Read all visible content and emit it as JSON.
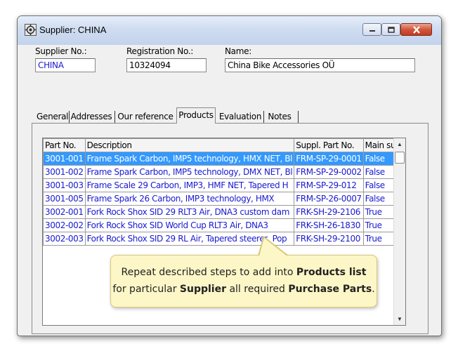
{
  "window": {
    "title": "Supplier: CHINA"
  },
  "fields": {
    "supplier_no": {
      "label": "Supplier No.:",
      "value": "CHINA"
    },
    "registration_no": {
      "label": "Registration No.:",
      "value": "10324094"
    },
    "name": {
      "label": "Name:",
      "value": "China Bike Accessories OÜ"
    }
  },
  "tabs": [
    "General",
    "Addresses",
    "Our reference",
    "Products",
    "Evaluation",
    "Notes"
  ],
  "active_tab": "Products",
  "products_table": {
    "columns": [
      "Part No.",
      "Description",
      "Suppl. Part No.",
      "Main suppl."
    ],
    "rows": [
      [
        "3001-001",
        "Frame Spark Carbon, IMP5 technology, HMX NET, Bl",
        "FRM-SP-29-0001",
        "False"
      ],
      [
        "3001-002",
        "Frame Spark Carbon, IMP5 technology, DMX NET, Bl",
        "FRM-SP-29-0002",
        "False"
      ],
      [
        "3001-003",
        "Frame Scale 29 Carbon, IMP3, HMF NET, Tapered H",
        "FRM-SP-29-012",
        "False"
      ],
      [
        "3001-005",
        "Frame Spark 26 Carbon, IMP3 technology, HMX",
        "FRM-SP-26-0007",
        "False"
      ],
      [
        "3002-001",
        "Fork Rock Shox SID 29 RLT3 Air, DNA3 custom dam",
        "FRK-SH-29-2106",
        "True"
      ],
      [
        "3002-002",
        "Fork Rock Shox SID World Cup RLT3 Air, DNA3",
        "FRK-SH-26-1830",
        "True"
      ],
      [
        "3002-003",
        "Fork Rock Shox SID 29 RL Air, Tapered steerer, Pop",
        "FRK-SH-29-2100",
        "True"
      ]
    ],
    "selected_row": 0
  },
  "callout": {
    "line1_prefix": "Repeat described steps to add into ",
    "line1_bold": "Products list",
    "line2_prefix": "for particular ",
    "line2_bold1": "Supplier",
    "line2_mid": " all required ",
    "line2_bold2": "Purchase Parts",
    "line2_suffix": "."
  },
  "colors": {
    "selection": "#3399ff",
    "row_text": "#1a1ad0",
    "callout_bg": "#fdf6c6",
    "close_button": "#c43c1e"
  }
}
